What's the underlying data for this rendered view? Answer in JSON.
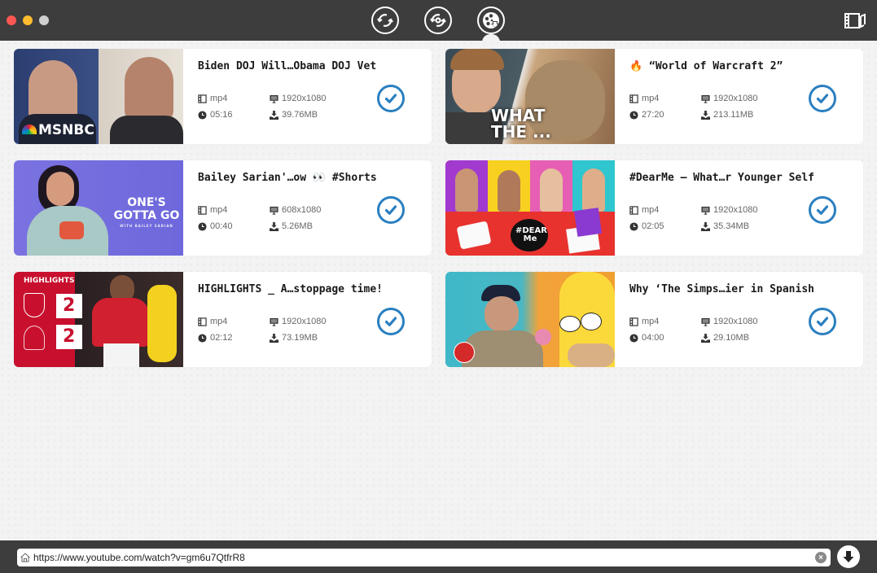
{
  "window": {
    "toolbar": {
      "modes": [
        {
          "name": "convert-mode",
          "icon": "rotate-arrows-icon"
        },
        {
          "name": "edit-convert-mode",
          "icon": "rotate-dot-icon"
        },
        {
          "name": "download-mode",
          "icon": "film-reel-download-icon",
          "active": true
        }
      ],
      "library_icon": "media-library-icon"
    }
  },
  "videos": [
    {
      "title": "Biden DOJ Will…Obama DOJ Vet",
      "format": "mp4",
      "duration": "05:16",
      "resolution": "1920x1080",
      "size": "39.76MB",
      "checked": true,
      "thumb_text": "MSNBC"
    },
    {
      "title": "🔥 “World of Warcraft 2”",
      "format": "mp4",
      "duration": "27:20",
      "resolution": "1920x1080",
      "size": "213.11MB",
      "checked": true,
      "thumb_text": "WHAT THE ..."
    },
    {
      "title": "Bailey Sarian'…ow 👀  #Shorts",
      "format": "mp4",
      "duration": "00:40",
      "resolution": "608x1080",
      "size": "5.26MB",
      "checked": true,
      "thumb_text": "ONE'S GOTTA GO",
      "thumb_subtext": "WITH BAILEY SARIAN"
    },
    {
      "title": "#DearMe – What…r Younger Self",
      "format": "mp4",
      "duration": "02:05",
      "resolution": "1920x1080",
      "size": "35.34MB",
      "checked": true,
      "thumb_text": "#DEAR Me"
    },
    {
      "title": "HIGHLIGHTS _ A…stoppage time!",
      "format": "mp4",
      "duration": "02:12",
      "resolution": "1920x1080",
      "size": "73.19MB",
      "checked": true,
      "thumb_text": "HIGHLIGHTS",
      "score_home": "2",
      "score_away": "2"
    },
    {
      "title": "Why ‘The Simps…ier in Spanish",
      "format": "mp4",
      "duration": "04:00",
      "resolution": "1920x1080",
      "size": "29.10MB",
      "checked": true
    }
  ],
  "url_bar": {
    "value": "https://www.youtube.com/watch?v=gm6u7QtfrR8",
    "clear_label": "×"
  },
  "colors": {
    "accent": "#2a7fc0",
    "titlebar": "#3d3d3d",
    "close": "#fc5753",
    "minimize": "#fdbc2e",
    "maximize": "#cfcfcf"
  }
}
